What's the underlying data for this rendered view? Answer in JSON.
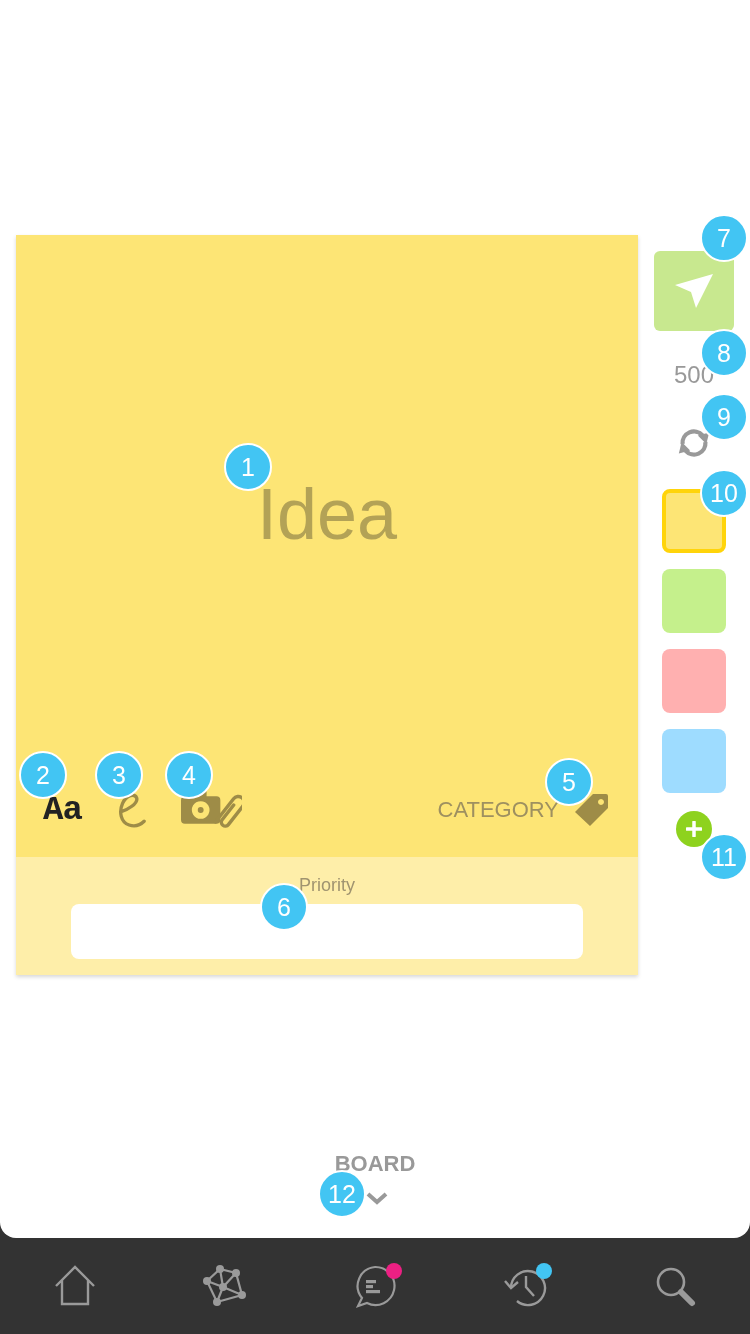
{
  "note": {
    "placeholder": "Idea",
    "font_button": "Aa",
    "category_button": "CATEGORY",
    "priority_label": "Priority"
  },
  "sidebar": {
    "count": "500",
    "colors": [
      {
        "color": "#fde575",
        "selected": true
      },
      {
        "color": "#c5f08c",
        "selected": false
      },
      {
        "color": "#ffb0b0",
        "selected": false
      },
      {
        "color": "#9edcff",
        "selected": false
      }
    ]
  },
  "board_toggle": {
    "label": "BOARD"
  },
  "tab_bar": {
    "items": [
      {
        "kind": "home",
        "badge": false
      },
      {
        "kind": "network",
        "badge": false
      },
      {
        "kind": "chat",
        "badge": true,
        "color": "#ec2083"
      },
      {
        "kind": "history",
        "badge": true,
        "color": "#42c5f3"
      },
      {
        "kind": "search",
        "badge": false
      }
    ]
  },
  "step_markers": [
    "1",
    "2",
    "3",
    "4",
    "5",
    "6",
    "7",
    "8",
    "9",
    "10",
    "11",
    "12"
  ]
}
